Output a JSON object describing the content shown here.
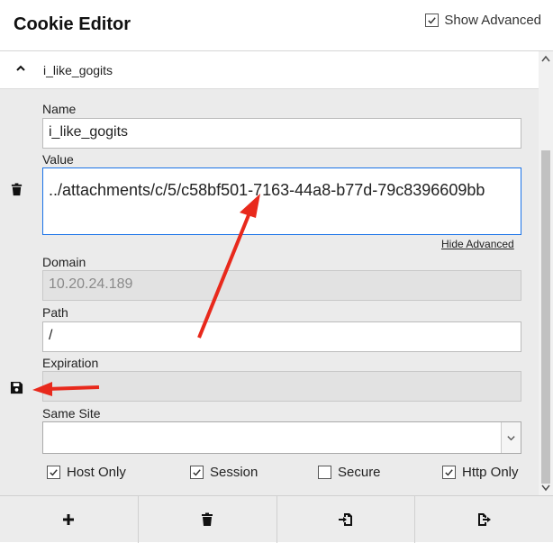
{
  "app": {
    "title": "Cookie Editor",
    "show_advanced_label": "Show Advanced",
    "show_advanced_checked": true
  },
  "cookie": {
    "name_header": "i_like_gogits",
    "fields": {
      "name_label": "Name",
      "name_value": "i_like_gogits",
      "value_label": "Value",
      "value_value": "../attachments/c/5/c58bf501-7163-44a8-b77d-79c8396609bb",
      "hide_advanced": "Hide Advanced",
      "domain_label": "Domain",
      "domain_value": "10.20.24.189",
      "path_label": "Path",
      "path_value": "/",
      "expiration_label": "Expiration",
      "expiration_value": "",
      "same_site_label": "Same Site",
      "same_site_value": ""
    },
    "flags": {
      "host_only": {
        "label": "Host Only",
        "checked": true
      },
      "session": {
        "label": "Session",
        "checked": true
      },
      "secure": {
        "label": "Secure",
        "checked": false
      },
      "http_only": {
        "label": "Http Only",
        "checked": true
      }
    }
  },
  "icons": {
    "delete_cookie": "trash-icon",
    "save_cookie": "floppy-disk-icon",
    "collapse": "chevron-up-icon",
    "select_arrow": "chevron-down-icon",
    "toolbar": [
      "plus-icon",
      "trash-icon",
      "import-icon",
      "export-icon"
    ]
  },
  "colors": {
    "panel_bg": "#ebebeb",
    "focus_border": "#1a73e8",
    "annotation_arrow": "#e8291c"
  }
}
